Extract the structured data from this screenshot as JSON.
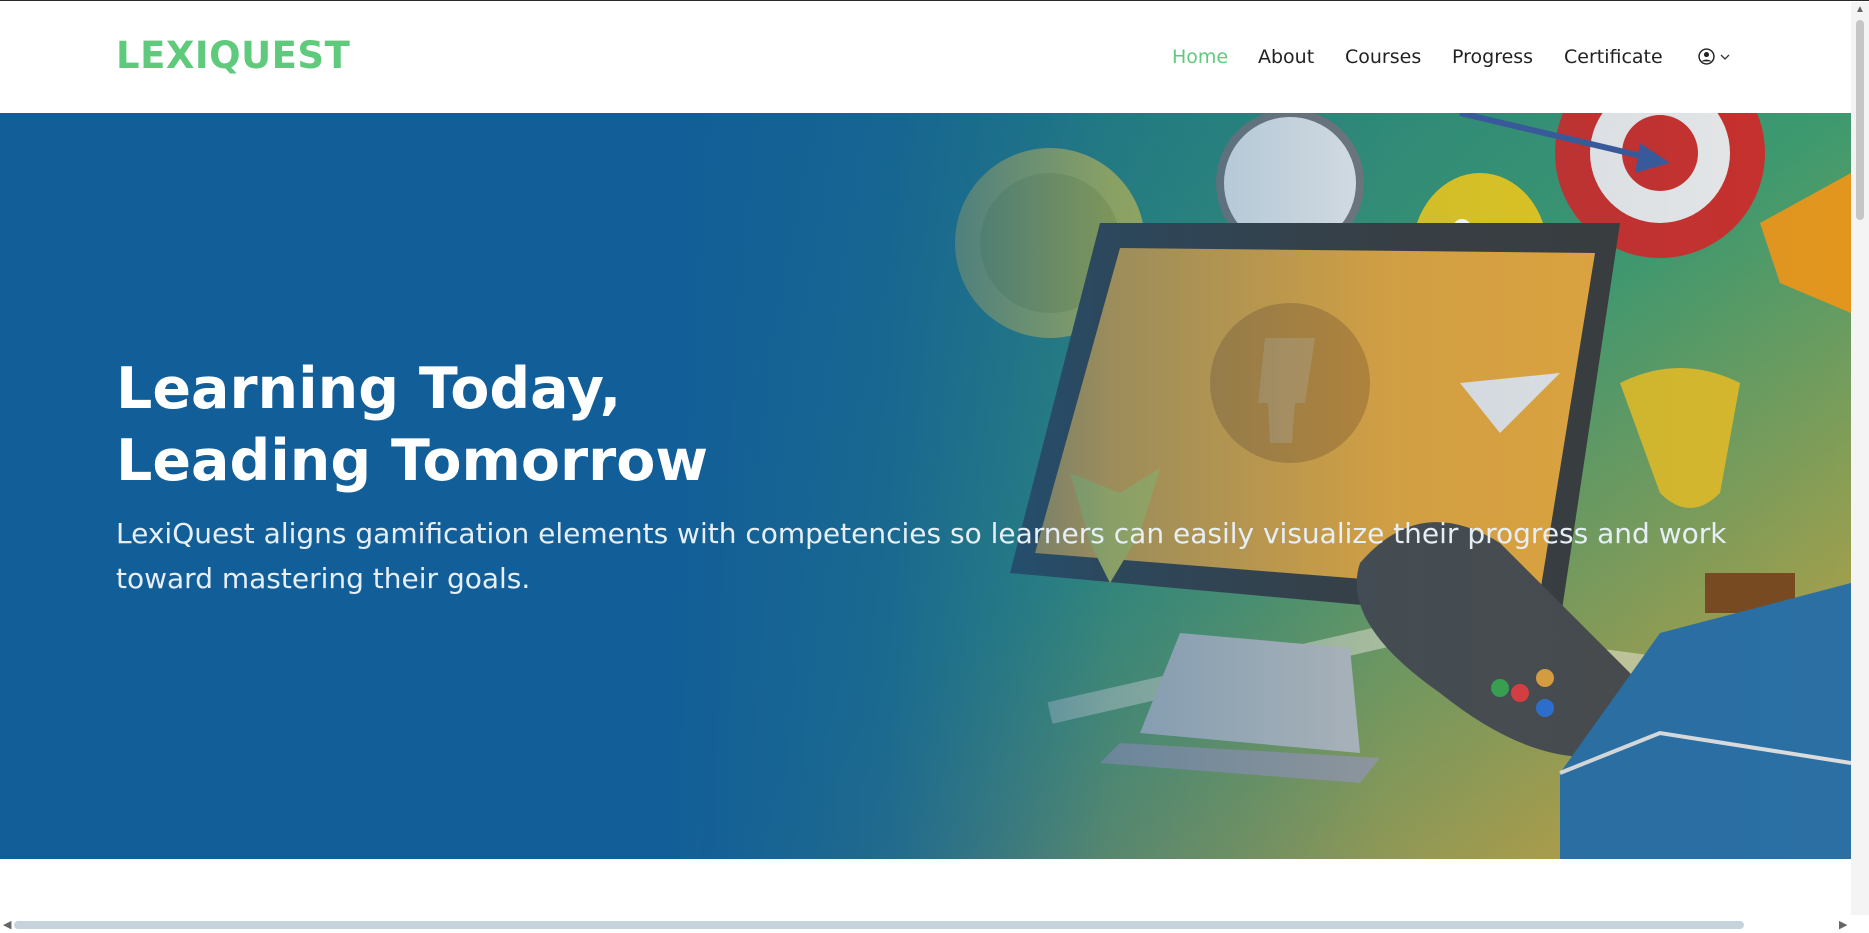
{
  "brand": {
    "name": "LEXIQUEST",
    "color": "#5fca7c"
  },
  "nav": {
    "items": [
      {
        "label": "Home",
        "active": true
      },
      {
        "label": "About",
        "active": false
      },
      {
        "label": "Courses",
        "active": false
      },
      {
        "label": "Progress",
        "active": false
      },
      {
        "label": "Certificate",
        "active": false
      }
    ],
    "user_icon": "user-circle-icon",
    "dropdown_icon": "chevron-down-icon"
  },
  "hero": {
    "title_line1": "Learning Today,",
    "title_line2": "Leading Tomorrow",
    "subtitle": "LexiQuest aligns gamification elements with competencies so learners can easily visualize their progress and work toward mastering their goals.",
    "background_color": "#11609a",
    "illustration": "gamification-illustration"
  },
  "colors": {
    "accent": "#5fca7c",
    "text_dark": "#222222",
    "hero_blue": "#125e98"
  }
}
